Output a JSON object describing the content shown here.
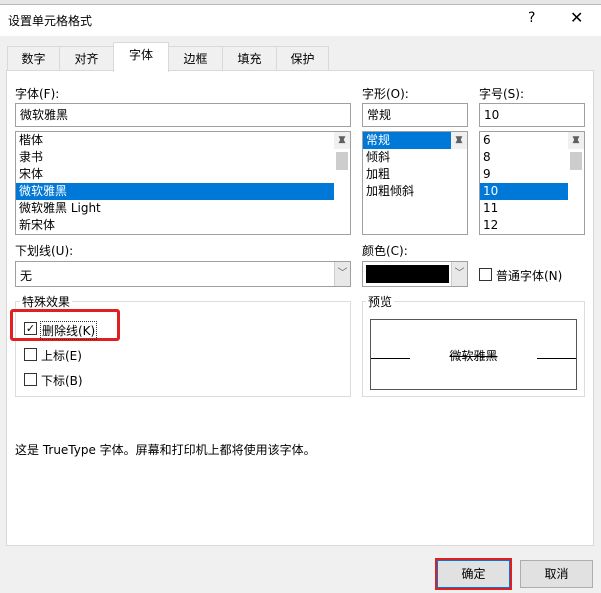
{
  "dialog": {
    "title": "设置单元格格式",
    "help": "?",
    "close": "✕"
  },
  "tabs": [
    "数字",
    "对齐",
    "字体",
    "边框",
    "填充",
    "保护"
  ],
  "font": {
    "label": "字体(F):",
    "value": "微软雅黑",
    "items": [
      "楷体",
      "隶书",
      "宋体",
      "微软雅黑",
      "微软雅黑 Light",
      "新宋体"
    ],
    "selected": 3
  },
  "style": {
    "label": "字形(O):",
    "value": "常规",
    "items": [
      "常规",
      "倾斜",
      "加粗",
      "加粗倾斜"
    ],
    "selected": 0
  },
  "size": {
    "label": "字号(S):",
    "value": "10",
    "items": [
      "6",
      "8",
      "9",
      "10",
      "11",
      "12"
    ],
    "selected": 3
  },
  "underline": {
    "label": "下划线(U):",
    "value": "无"
  },
  "color": {
    "label": "颜色(C):",
    "value": "#000000",
    "normal_font": "普通字体(N)"
  },
  "effects": {
    "label": "特殊效果",
    "strikethrough": "删除线(K)",
    "superscript": "上标(E)",
    "subscript": "下标(B)",
    "strikethrough_checked": true
  },
  "preview": {
    "label": "预览",
    "text": "微软雅黑"
  },
  "info": "这是 TrueType 字体。屏幕和打印机上都将使用该字体。",
  "buttons": {
    "ok": "确定",
    "cancel": "取消"
  },
  "highlight_color": "#e02020"
}
